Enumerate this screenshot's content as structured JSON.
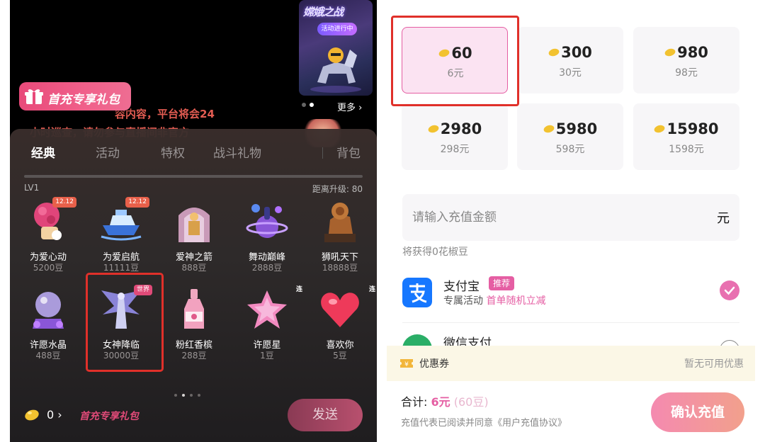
{
  "live_view": {
    "promo_card": {
      "title": "嫦娥之战",
      "tag": "活动进行中"
    },
    "more_link": "更多 ›",
    "first_charge_banner": "首充专享礼包",
    "notice_line1": "容内容，平台将会24",
    "notice_line2": "小时巡查，请勿参与直播间非官方",
    "carousel_dots": 2
  },
  "gift_panel": {
    "tabs": [
      {
        "label": "经典",
        "active": true
      },
      {
        "label": "活动",
        "active": false
      },
      {
        "label": "特权",
        "active": false
      },
      {
        "label": "战斗礼物",
        "active": false
      },
      {
        "label": "背包",
        "active": false
      }
    ],
    "level": "LV1",
    "distance_to_upgrade": "距离升级: 80",
    "progress_fraction": 0.0,
    "gifts": [
      {
        "name": "为爱心动",
        "price": "5200豆",
        "badge": "12.12",
        "badge_type": "date",
        "icon": "heart-rose-icon"
      },
      {
        "name": "为爱启航",
        "price": "11111豆",
        "badge": "12.12",
        "badge_type": "date",
        "icon": "yacht-icon"
      },
      {
        "name": "爱神之箭",
        "price": "888豆",
        "badge": "",
        "badge_type": "",
        "icon": "cupid-arrow-icon"
      },
      {
        "name": "舞动巅峰",
        "price": "2888豆",
        "badge": "",
        "badge_type": "",
        "icon": "planet-dance-icon"
      },
      {
        "name": "狮吼天下",
        "price": "18888豆",
        "badge": "",
        "badge_type": "",
        "icon": "lion-statue-icon"
      },
      {
        "name": "许愿水晶",
        "price": "488豆",
        "badge": "",
        "badge_type": "",
        "icon": "crystal-ball-icon"
      },
      {
        "name": "女神降临",
        "price": "30000豆",
        "badge": "世界",
        "badge_type": "world",
        "icon": "goddess-icon"
      },
      {
        "name": "粉红香槟",
        "price": "288豆",
        "badge": "",
        "badge_type": "",
        "icon": "champagne-icon"
      },
      {
        "name": "许愿星",
        "price": "1豆",
        "badge": "连",
        "badge_type": "lian",
        "icon": "wish-star-icon"
      },
      {
        "name": "喜欢你",
        "price": "5豆",
        "badge": "连",
        "badge_type": "lian",
        "icon": "heart-icon"
      }
    ],
    "page_dots": 4,
    "active_page": 1,
    "bean_balance": "0",
    "bean_arrow": "›",
    "mini_first_charge": "首充专享礼包",
    "send_button": "发送"
  },
  "recharge": {
    "amounts": [
      {
        "beans": "60",
        "yuan": "6元",
        "selected": true
      },
      {
        "beans": "300",
        "yuan": "30元",
        "selected": false
      },
      {
        "beans": "980",
        "yuan": "98元",
        "selected": false
      },
      {
        "beans": "2980",
        "yuan": "298元",
        "selected": false
      },
      {
        "beans": "5980",
        "yuan": "598元",
        "selected": false
      },
      {
        "beans": "15980",
        "yuan": "1598元",
        "selected": false
      }
    ],
    "input_placeholder": "请输入充值金额",
    "input_unit": "元",
    "earn_text": "将获得0花椒豆",
    "payments": [
      {
        "name": "支付宝",
        "tag": "推荐",
        "sub_prefix": "专属活动",
        "sub_highlight": "首单随机立减",
        "selected": true
      },
      {
        "name": "微信支付",
        "tag": "",
        "sub_prefix": "",
        "sub_highlight": "",
        "selected": false
      }
    ],
    "coupon_label": "优惠券",
    "coupon_status": "暂无可用优惠",
    "total_label": "合计:",
    "total_rmb": "6元",
    "total_beans": "(60豆)",
    "agreement": "充值代表已阅读并同意《用户充值协议》",
    "confirm_button": "确认充值",
    "accent": "#e55ea3"
  }
}
